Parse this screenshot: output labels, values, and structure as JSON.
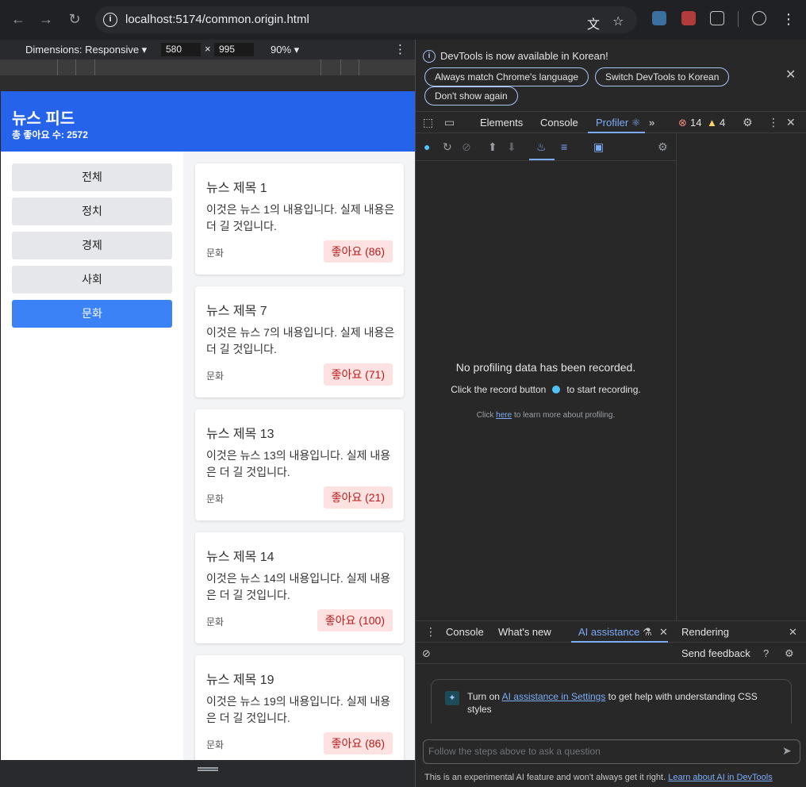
{
  "browser": {
    "url": "localhost:5174/common.origin.html",
    "back_icon": "arrow-left-icon",
    "forward_icon": "arrow-right-icon",
    "reload_icon": "reload-icon"
  },
  "device_toolbar": {
    "dimensions_label": "Dimensions: Responsive ▾",
    "width": "580",
    "height": "995",
    "separator": "×",
    "zoom": "90% ▾"
  },
  "app": {
    "title": "뉴스 피드",
    "total_likes": "총 좋아요 수: 2572",
    "categories": [
      "전체",
      "정치",
      "경제",
      "사회",
      "문화"
    ],
    "active_category": "문화",
    "news": [
      {
        "title": "뉴스 제목 1",
        "body": "이것은 뉴스 1의 내용입니다. 실제 내용은 더 길 것입니다.",
        "category": "문화",
        "like": "좋아요 (86)"
      },
      {
        "title": "뉴스 제목 7",
        "body": "이것은 뉴스 7의 내용입니다. 실제 내용은 더 길 것입니다.",
        "category": "문화",
        "like": "좋아요 (71)"
      },
      {
        "title": "뉴스 제목 13",
        "body": "이것은 뉴스 13의 내용입니다. 실제 내용은 더 길 것입니다.",
        "category": "문화",
        "like": "좋아요 (21)"
      },
      {
        "title": "뉴스 제목 14",
        "body": "이것은 뉴스 14의 내용입니다. 실제 내용은 더 길 것입니다.",
        "category": "문화",
        "like": "좋아요 (100)"
      },
      {
        "title": "뉴스 제목 19",
        "body": "이것은 뉴스 19의 내용입니다. 실제 내용은 더 길 것입니다.",
        "category": "문화",
        "like": "좋아요 (86)"
      }
    ]
  },
  "devtools": {
    "infobar": {
      "message": "DevTools is now available in Korean!",
      "btn_match": "Always match Chrome's language",
      "btn_switch": "Switch DevTools to Korean",
      "btn_dont_show": "Don't show again"
    },
    "tabs": {
      "elements": "Elements",
      "console": "Console",
      "profiler": "Profiler ⚛",
      "more": "»",
      "errors": "14",
      "warnings": "4"
    },
    "profiler": {
      "empty_title": "No profiling data has been recorded.",
      "empty_hint_before": "Click the record button",
      "empty_hint_after": "to start recording.",
      "learn_before": "Click",
      "learn_link": "here",
      "learn_after": "to learn more about profiling."
    },
    "drawer": {
      "tab_console": "Console",
      "tab_whats_new": "What's new",
      "tab_ai": "AI assistance",
      "tab_rendering": "Rendering",
      "send_feedback": "Send feedback"
    },
    "ai": {
      "card_before": "Turn on",
      "card_link": "AI assistance in Settings",
      "card_after": "to get help with understanding CSS styles",
      "ask_placeholder": "Follow the steps above to ask a question",
      "disclaimer": "This is an experimental AI feature and won't always get it right.",
      "disclaimer_link": "Learn about AI in DevTools"
    }
  }
}
